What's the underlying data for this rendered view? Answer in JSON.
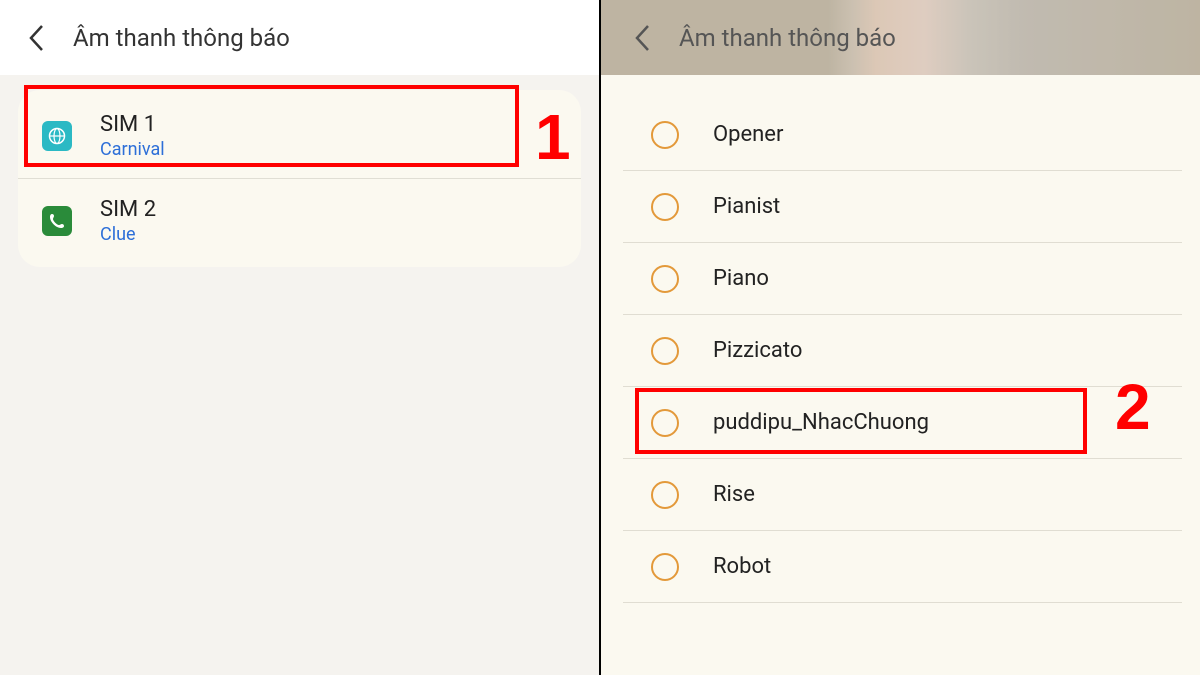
{
  "left": {
    "title": "Âm thanh thông báo",
    "sims": [
      {
        "label": "SIM 1",
        "sub": "Carnival",
        "icon": "globe"
      },
      {
        "label": "SIM 2",
        "sub": "Clue",
        "icon": "phone"
      }
    ]
  },
  "right": {
    "title": "Âm thanh thông báo",
    "sounds": [
      "Opener",
      "Pianist",
      "Piano",
      "Pizzicato",
      "puddipu_NhacChuong",
      "Rise",
      "Robot"
    ]
  },
  "annotations": {
    "n1": "1",
    "n2": "2"
  }
}
